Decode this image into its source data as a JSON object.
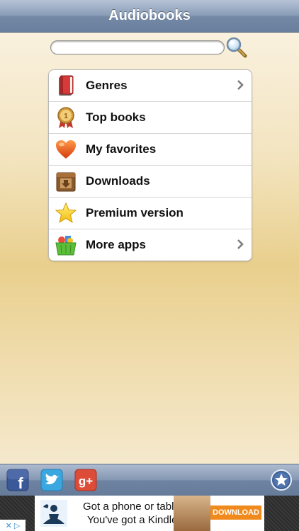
{
  "navbar": {
    "title": "Audiobooks"
  },
  "search": {
    "value": "",
    "placeholder": "",
    "icon": "magnifier-icon"
  },
  "menu": {
    "items": [
      {
        "label": "Genres",
        "icon": "book-icon",
        "chevron": true
      },
      {
        "label": "Top books",
        "icon": "medal-icon",
        "chevron": false
      },
      {
        "label": "My favorites",
        "icon": "heart-icon",
        "chevron": false
      },
      {
        "label": "Downloads",
        "icon": "download-box-icon",
        "chevron": false
      },
      {
        "label": "Premium version",
        "icon": "star-icon",
        "chevron": false
      },
      {
        "label": "More apps",
        "icon": "shopping-basket-icon",
        "chevron": true
      }
    ]
  },
  "toolbar": {
    "facebook_label": "f",
    "google_plus_label": "g+",
    "icons": [
      "facebook-icon",
      "twitter-icon",
      "google-plus-icon",
      "favorites-star-icon"
    ]
  },
  "ad": {
    "line1": "Got a phone or tablet?",
    "line2": "You've got a Kindle.",
    "cta": "DOWNLOAD",
    "cta_color": "#f08a1c"
  },
  "adchoices": {
    "label": "✕ ▷"
  },
  "colors": {
    "navbar": "#7489a6",
    "accent_orange": "#f08a1c"
  }
}
